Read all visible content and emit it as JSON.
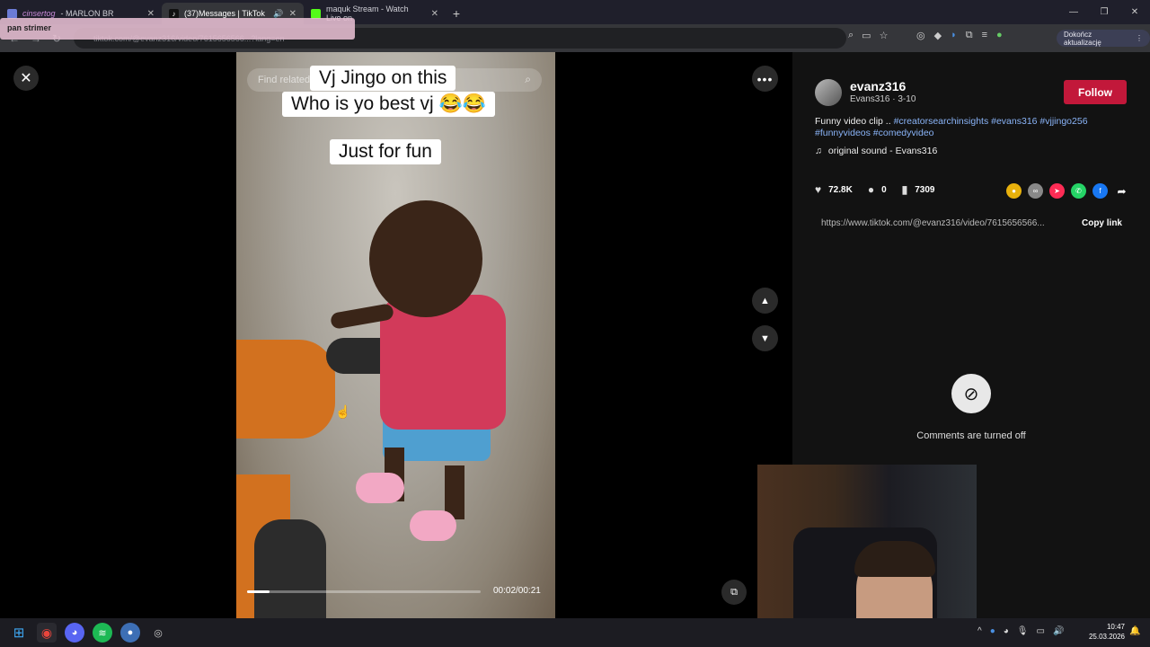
{
  "browser": {
    "tabs": [
      {
        "label": "- MARLON BR",
        "prefix": "cinsertog",
        "active": false
      },
      {
        "label": "(37)Messages | TikTok",
        "active": true
      },
      {
        "label": "maquk Stream - Watch Live on",
        "active": false
      }
    ],
    "address": "tiktok.com/@evanz316/video/7615656566...?lang=en",
    "update_button": "Dokończ aktualizację",
    "tooltip": "pan strimer"
  },
  "video": {
    "search_placeholder": "Find related",
    "captions": [
      "Vj Jingo on this",
      "Who is yo best vj 😂😂",
      "Just for fun"
    ],
    "timecode": "00:02/00:21",
    "progress": 0.095
  },
  "author": {
    "username": "evanz316",
    "subline": "Evans316 · 3-10",
    "follow_label": "Follow"
  },
  "description": {
    "text": "Funny video clip ..",
    "tags_line1": "#creatorsearchinsights #evans316 #vjjingo256",
    "tags_line2": "#funnyvideos #comedyvideo"
  },
  "sound": "original sound - Evans316",
  "stats": {
    "likes": "72.8K",
    "comments": "0",
    "saves": "7309"
  },
  "link": {
    "url": "https://www.tiktok.com/@evanz316/video/7615656566...",
    "copy_label": "Copy link"
  },
  "comments_off_text": "Comments are turned off",
  "clock": {
    "time": "10:47",
    "date": "25.03.2026"
  },
  "colors": {
    "follow": "#c2183a",
    "hashtag": "#8ab4f8"
  }
}
